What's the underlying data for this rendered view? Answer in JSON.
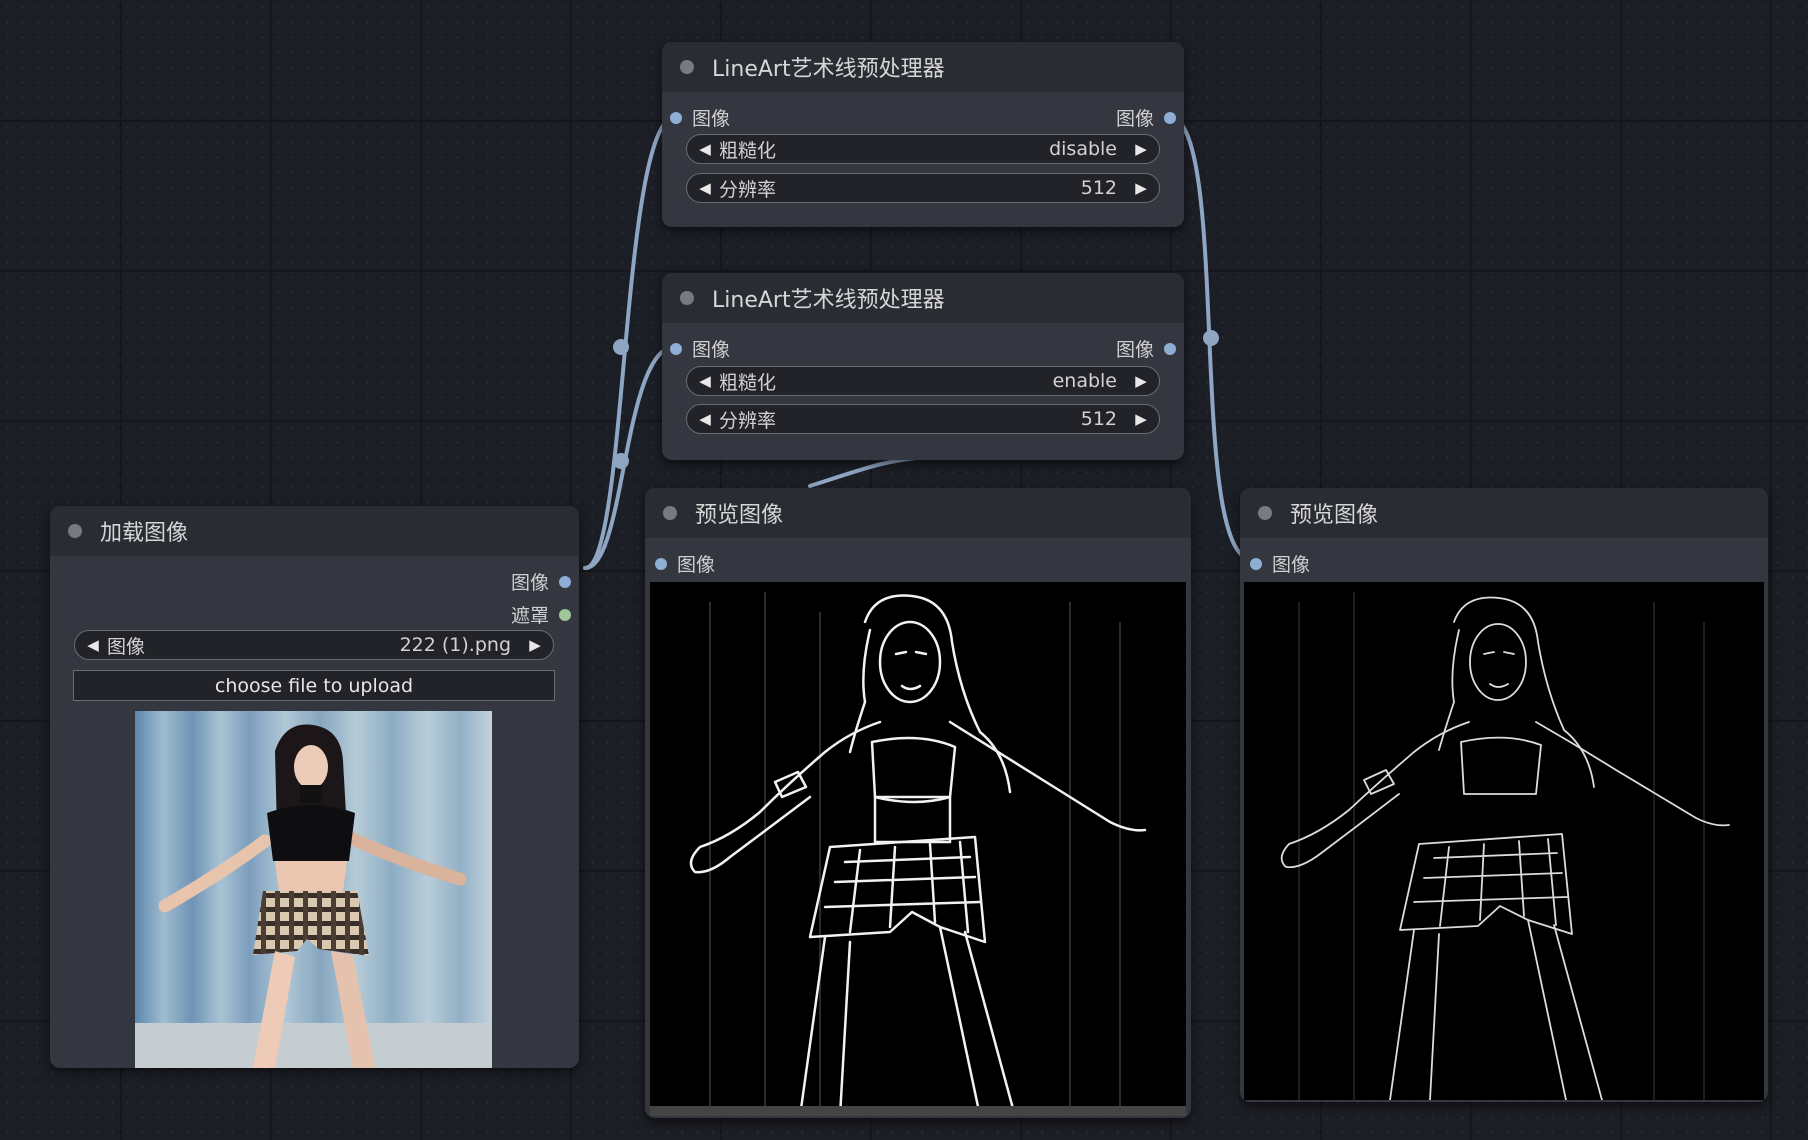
{
  "lineart_node_1": {
    "title": "LineArt艺术线预处理器",
    "input_label": "图像",
    "output_label": "图像",
    "coarse_label": "粗糙化",
    "coarse_value": "disable",
    "resolution_label": "分辨率",
    "resolution_value": "512"
  },
  "lineart_node_2": {
    "title": "LineArt艺术线预处理器",
    "input_label": "图像",
    "output_label": "图像",
    "coarse_label": "粗糙化",
    "coarse_value": "enable",
    "resolution_label": "分辨率",
    "resolution_value": "512"
  },
  "load_image_node": {
    "title": "加载图像",
    "output_image_label": "图像",
    "output_mask_label": "遮罩",
    "image_widget_label": "图像",
    "image_widget_value": "222 (1).png",
    "upload_button": "choose file to upload"
  },
  "preview_node_1": {
    "title": "预览图像",
    "input_label": "图像"
  },
  "preview_node_2": {
    "title": "预览图像",
    "input_label": "图像"
  },
  "icons": {
    "left_arrow": "triangle-left-icon",
    "right_arrow": "triangle-right-icon",
    "collapse": "collapse-dot-icon"
  },
  "colors": {
    "canvas": "#1c1e25",
    "node_body": "#353740",
    "node_header": "#2a2c33",
    "link": "#8ea6c2",
    "image_slot": "#8eaed6",
    "mask_slot": "#9ec69a"
  }
}
